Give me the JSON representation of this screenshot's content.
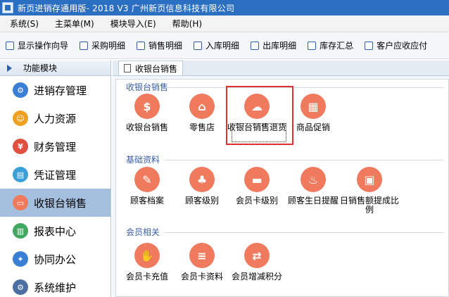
{
  "window": {
    "title": "新页进销存通用版- 2018 V3 广州新页信息科技有限公司"
  },
  "menubar": {
    "items": [
      "系统(S)",
      "主菜单(M)",
      "模块导入(E)",
      "帮助(H)"
    ]
  },
  "toolbar": {
    "items": [
      "显示操作向导",
      "采购明细",
      "销售明细",
      "入库明细",
      "出库明细",
      "库存汇总",
      "客户应收应付"
    ]
  },
  "sidebar": {
    "header": "功能模块",
    "items": [
      {
        "label": "进销存管理",
        "icon": "gear-icon",
        "color": "#3a7fd5"
      },
      {
        "label": "人力资源",
        "icon": "people-icon",
        "color": "#f0a020"
      },
      {
        "label": "财务管理",
        "icon": "yen-icon",
        "color": "#e05040"
      },
      {
        "label": "凭证管理",
        "icon": "voucher-icon",
        "color": "#3aa0d8"
      },
      {
        "label": "收银台销售",
        "icon": "cashier-icon",
        "color": "#ef7a5e"
      },
      {
        "label": "报表中心",
        "icon": "report-icon",
        "color": "#40a860"
      },
      {
        "label": "协同办公",
        "icon": "collab-icon",
        "color": "#3a7fd5"
      },
      {
        "label": "系统维护",
        "icon": "maintenance-icon",
        "color": "#4a6fa0"
      }
    ],
    "active_index": 4
  },
  "tab": {
    "label": "收银台销售"
  },
  "groups": [
    {
      "title": "收银台销售",
      "tiles": [
        {
          "label": "收银台销售",
          "icon": "cash-register-icon"
        },
        {
          "label": "零售店",
          "icon": "store-icon"
        },
        {
          "label": "收银台销售退货",
          "icon": "cloud-upload-icon"
        },
        {
          "label": "商品促销",
          "icon": "basket-icon"
        }
      ]
    },
    {
      "title": "基础资料",
      "tiles": [
        {
          "label": "顾客档案",
          "icon": "customer-file-icon"
        },
        {
          "label": "顾客级别",
          "icon": "hierarchy-icon"
        },
        {
          "label": "会员卡级别",
          "icon": "member-card-level-icon"
        },
        {
          "label": "顾客生日提醒",
          "icon": "birthday-cake-icon"
        },
        {
          "label": "日销售额提成比例",
          "icon": "commission-icon"
        }
      ]
    },
    {
      "title": "会员相关",
      "tiles": [
        {
          "label": "会员卡充值",
          "icon": "card-recharge-icon"
        },
        {
          "label": "会员卡资料",
          "icon": "card-info-icon"
        },
        {
          "label": "会员增减积分",
          "icon": "points-exchange-icon"
        }
      ]
    }
  ],
  "colors": {
    "titlebar": "#2b6fc2",
    "tile_icon": "#ef7a5e",
    "sidebar_active": "#a5bfdf",
    "group_title": "#3b5da5",
    "selection": "#e03030"
  }
}
